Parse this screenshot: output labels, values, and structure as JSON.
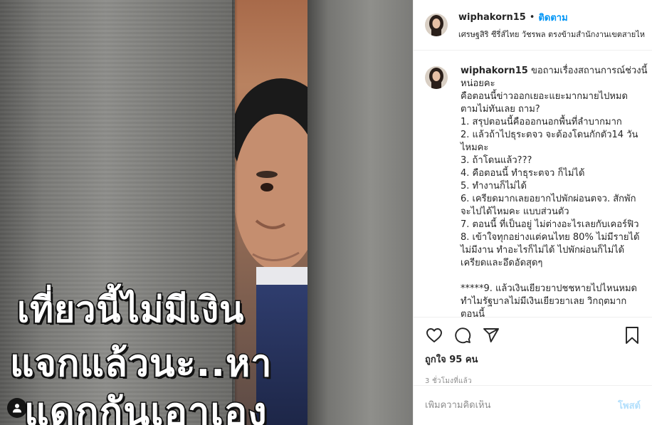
{
  "image": {
    "caption_lines": [
      "เที่ยวนี้ไม่มีเงิน",
      "แจกแล้วนะ..หา",
      "แดกกันเอาเอง"
    ],
    "tag_icon": "user-icon"
  },
  "header": {
    "username": "wiphakorn15",
    "separator": "•",
    "follow_label": "ติดตาม",
    "location": "เศรษฐสิริ ซีรี่ส์ไทย วัชรพล ตรงข้ามสำนักงานเขตสายไหม"
  },
  "caption": {
    "username": "wiphakorn15",
    "lines": [
      "ขอถามเรื่องสถานการณ์ช่วงนี้",
      "หน่อยคะ",
      "คือตอนนี้ข่าวออกเยอะแยะมากมายไปหมด",
      "ตามไม่ทันเลย ถาม?",
      "1. สรุปตอนนี้คือออกนอกพื้นที่ลำบากมาก",
      "2. แล้วถ้าไปธุระตจว จะต้องโดนกักตัว14 วัน",
      "ไหมคะ",
      "3. ถ้าโดนแล้ว???",
      "4. คือตอนนี้ ทำธุระตจว ก็ไม่ได้",
      "5. ทำงานก็ไม่ได้",
      "6. เครียดมากเลยอยากไปพักผ่อนตจว. สักพัก",
      "จะไปได้ไหมคะ แบบส่วนตัว",
      "7. ตอนนี้ ที่เป็นอยู่ ไม่ต่างอะไรเลยกับเคอร์ฟิว",
      "8. เข้าใจทุกอย่างแต่คนไทย 80% ไม่มีรายได้",
      "ไม่มีงาน ทำอะไรก็ไม่ได้ ไปพักผ่อนก็ไม่ได้",
      "เครียดและอึดอัดสุดๆ",
      "",
      "*****9. แล้วเงินเยียวยาปชชหายไปไหนหมด",
      "ทำไมรัฐบาลไม่มีเงินเยียวยาเลย วิกฤตมาก",
      "ตอนนี้"
    ]
  },
  "actions": {
    "icons": [
      "heart-icon",
      "comment-icon",
      "share-icon",
      "bookmark-icon"
    ],
    "likes": "ถูกใจ 95 คน",
    "time": "3 ชั่วโมงที่แล้ว"
  },
  "comment_box": {
    "placeholder": "เพิ่มความคิดเห็น",
    "post_label": "โพสต์"
  },
  "colors": {
    "accent": "#0095f6",
    "post_disabled": "#b2dffc",
    "muted": "#8e8e8e"
  }
}
